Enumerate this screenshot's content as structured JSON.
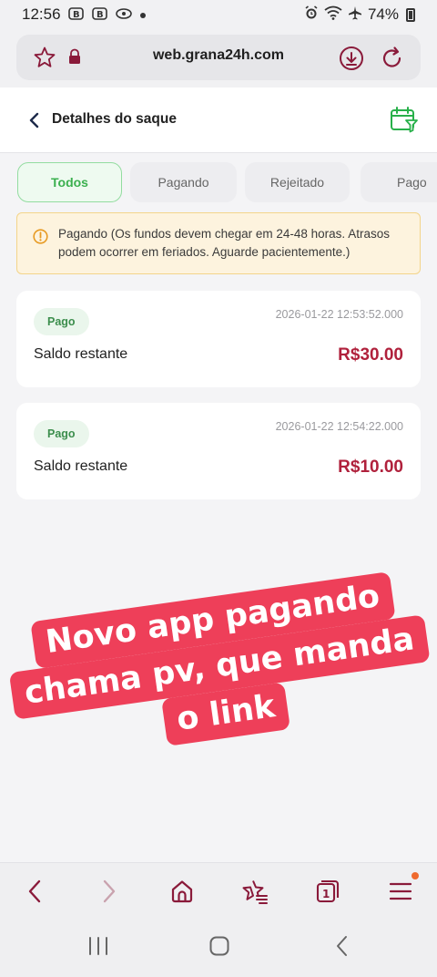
{
  "status_bar": {
    "time": "12:56",
    "battery": "74%",
    "icons": [
      "notification-b-icon",
      "notification-b-icon",
      "notification-disc-icon",
      "dot-icon",
      "alarm-icon",
      "wifi-icon",
      "airplane-icon",
      "battery-icon"
    ]
  },
  "browser": {
    "url": "web.grana24h.com",
    "icons": [
      "star-icon",
      "lock-icon",
      "download-icon",
      "reload-icon"
    ]
  },
  "header": {
    "title": "Detalhes do saque",
    "icons": [
      "back-chevron-icon",
      "calendar-filter-icon"
    ]
  },
  "tabs": [
    {
      "label": "Todos",
      "active": true
    },
    {
      "label": "Pagando",
      "active": false
    },
    {
      "label": "Rejeitado",
      "active": false
    },
    {
      "label": "Pago",
      "active": false
    }
  ],
  "notice": {
    "text": "Pagando (Os fundos devem chegar em 24-48 horas. Atrasos podem ocorrer em feriados. Aguarde pacientemente.)",
    "icon": "info-icon"
  },
  "withdrawals": [
    {
      "status": "Pago",
      "datetime": "2026-01-22 12:53:52.000",
      "label": "Saldo restante",
      "amount": "R$30.00"
    },
    {
      "status": "Pago",
      "datetime": "2026-01-22 12:54:22.000",
      "label": "Saldo restante",
      "amount": "R$10.00"
    }
  ],
  "overlay": {
    "lines": [
      "Novo app pagando",
      "chama pv, que manda",
      "o link"
    ]
  },
  "colors": {
    "accent_green": "#3bb04f",
    "amount_red": "#b0213c",
    "overlay_red": "#ee3f59",
    "nav_maroon": "#8a1a3a",
    "notice_bg": "#fdf3de"
  },
  "bottom_nav": {
    "items": [
      "back-icon",
      "forward-icon",
      "home-icon",
      "bookmarks-icon",
      "tabs-icon",
      "menu-icon"
    ],
    "tabs_count": "1"
  },
  "system_nav": {
    "items": [
      "recents-icon",
      "home-circle-icon",
      "back-system-icon"
    ]
  }
}
